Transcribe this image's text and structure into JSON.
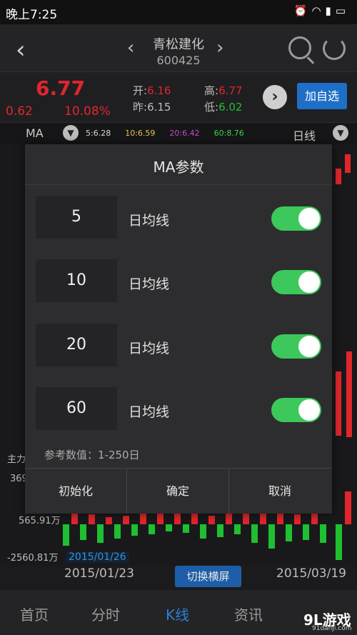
{
  "status_bar": {
    "time": "晚上7:25",
    "icons": [
      "alarm-icon",
      "wifi-icon",
      "signal-icon",
      "battery-icon"
    ]
  },
  "header": {
    "stock_name": "青松建化",
    "stock_code": "600425"
  },
  "quote": {
    "price": "6.77",
    "change": "0.62",
    "change_pct": "10.08%",
    "open_label": "开:",
    "open_value": "6.16",
    "prev_label": "昨:",
    "prev_value": "6.15",
    "high_label": "高:",
    "high_value": "6.77",
    "low_label": "低:",
    "low_value": "6.02",
    "add_watch_label": "加自选"
  },
  "ma_bar": {
    "label": "MA",
    "values": [
      {
        "text": "5:6.28",
        "color": "#d8d8d8"
      },
      {
        "text": "10:6.59",
        "color": "#e8c64a"
      },
      {
        "text": "20:6.42",
        "color": "#c64ad0"
      },
      {
        "text": "60:8.76",
        "color": "#3fd24a"
      }
    ],
    "period": "日线"
  },
  "chart": {
    "section_label": "主力",
    "y_labels": [
      "369",
      "565.91万",
      "-2560.81万"
    ],
    "x_start": "2015/01/23",
    "x_end": "2015/03/19",
    "selected_date": "2015/01/26",
    "switch_label": "切换横屏"
  },
  "dialog": {
    "title": "MA参数",
    "rows": [
      {
        "value": "5",
        "label": "日均线",
        "enabled": true
      },
      {
        "value": "10",
        "label": "日均线",
        "enabled": true
      },
      {
        "value": "20",
        "label": "日均线",
        "enabled": true
      },
      {
        "value": "60",
        "label": "日均线",
        "enabled": true
      }
    ],
    "hint": "参考数值：1-250日",
    "buttons": {
      "reset": "初始化",
      "confirm": "确定",
      "cancel": "取消"
    }
  },
  "bottom_nav": {
    "tabs": [
      {
        "label": "首页",
        "active": false
      },
      {
        "label": "分时",
        "active": false
      },
      {
        "label": "K线",
        "active": true
      },
      {
        "label": "资讯",
        "active": false
      }
    ]
  },
  "watermark": {
    "main": "9L游戏",
    "sub": "91danji.com"
  }
}
